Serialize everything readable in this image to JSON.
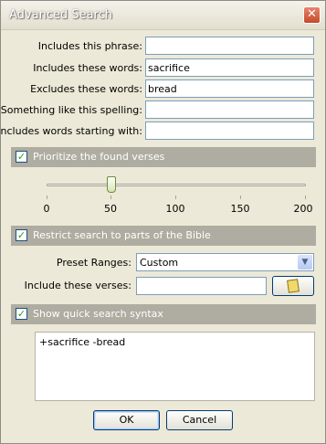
{
  "window": {
    "title": "Advanced Search"
  },
  "fields": [
    {
      "label": "Includes this phrase:",
      "value": ""
    },
    {
      "label": "Includes these words:",
      "value": "sacrifice"
    },
    {
      "label": "Excludes these words:",
      "value": "bread"
    },
    {
      "label": "Something like this spelling:",
      "value": ""
    },
    {
      "label": "Includes words starting with:",
      "value": ""
    }
  ],
  "prioritize": {
    "label": "Prioritize the found verses",
    "checked": true,
    "slider": {
      "value": 50,
      "min": 0,
      "max": 200,
      "ticks": [
        "0",
        "50",
        "100",
        "150",
        "200"
      ]
    }
  },
  "restrict": {
    "label": "Restrict search to parts of the Bible",
    "checked": true,
    "preset_label": "Preset Ranges:",
    "preset_value": "Custom",
    "include_label": "Include these verses:",
    "include_value": ""
  },
  "syntax": {
    "label": "Show quick search syntax",
    "checked": true,
    "text": "+sacrifice -bread"
  },
  "buttons": {
    "ok": "OK",
    "cancel": "Cancel"
  },
  "icons": {
    "close": "close-icon",
    "checkbox": "checkmark-icon",
    "book": "book-icon"
  }
}
